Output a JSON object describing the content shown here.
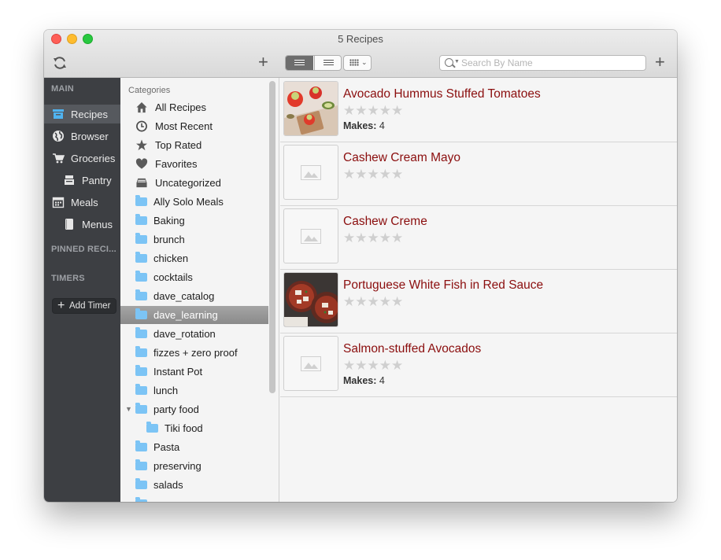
{
  "window": {
    "title": "5 Recipes"
  },
  "toolbar": {
    "search_placeholder": "Search By Name"
  },
  "sidebar": {
    "main_header": "MAIN",
    "items": [
      {
        "label": "Recipes",
        "icon": "recipe-box-icon",
        "selected": true
      },
      {
        "label": "Browser",
        "icon": "globe-icon",
        "selected": false
      },
      {
        "label": "Groceries",
        "icon": "cart-icon",
        "selected": false
      },
      {
        "label": "Pantry",
        "icon": "pantry-icon",
        "selected": false
      },
      {
        "label": "Meals",
        "icon": "calendar-icon",
        "selected": false
      },
      {
        "label": "Menus",
        "icon": "menu-book-icon",
        "selected": false
      }
    ],
    "pinned_header": "PINNED RECI...",
    "timers_header": "TIMERS",
    "add_timer_label": "Add Timer"
  },
  "categories": {
    "title": "Categories",
    "items": [
      {
        "label": "All Recipes",
        "icon": "home-icon"
      },
      {
        "label": "Most Recent",
        "icon": "clock-icon"
      },
      {
        "label": "Top Rated",
        "icon": "star-icon"
      },
      {
        "label": "Favorites",
        "icon": "heart-icon"
      },
      {
        "label": "Uncategorized",
        "icon": "tray-icon"
      },
      {
        "label": "Ally Solo Meals",
        "icon": "folder-icon"
      },
      {
        "label": "Baking",
        "icon": "folder-icon"
      },
      {
        "label": "brunch",
        "icon": "folder-icon"
      },
      {
        "label": "chicken",
        "icon": "folder-icon"
      },
      {
        "label": "cocktails",
        "icon": "folder-icon"
      },
      {
        "label": "dave_catalog",
        "icon": "folder-icon"
      },
      {
        "label": "dave_learning",
        "icon": "folder-icon",
        "selected": true
      },
      {
        "label": "dave_rotation",
        "icon": "folder-icon"
      },
      {
        "label": "fizzes + zero proof",
        "icon": "folder-icon"
      },
      {
        "label": "Instant Pot",
        "icon": "folder-icon"
      },
      {
        "label": "lunch",
        "icon": "folder-icon"
      },
      {
        "label": "party food",
        "icon": "folder-icon",
        "expanded": true
      },
      {
        "label": "Tiki food",
        "icon": "folder-icon",
        "indent": 1
      },
      {
        "label": "Pasta",
        "icon": "folder-icon"
      },
      {
        "label": "preserving",
        "icon": "folder-icon"
      },
      {
        "label": "salads",
        "icon": "folder-icon"
      }
    ]
  },
  "recipes": [
    {
      "name": "Avocado Hummus Stuffed Tomatoes",
      "rating": 0,
      "makes_label": "Makes:",
      "makes_value": "4",
      "image": "tomatoes-photo"
    },
    {
      "name": "Cashew Cream Mayo",
      "rating": 0,
      "makes_label": "",
      "makes_value": "",
      "image": "placeholder"
    },
    {
      "name": "Cashew Creme",
      "rating": 0,
      "makes_label": "",
      "makes_value": "",
      "image": "placeholder"
    },
    {
      "name": "Portuguese White Fish in Red Sauce",
      "rating": 0,
      "makes_label": "",
      "makes_value": "",
      "image": "fish-photo"
    },
    {
      "name": "Salmon-stuffed Avocados",
      "rating": 0,
      "makes_label": "Makes:",
      "makes_value": "4",
      "image": "placeholder"
    }
  ],
  "colors": {
    "recipe_title": "#8b0e0e",
    "sidebar_bg": "#3d3f43",
    "folder": "#7cc4f5"
  }
}
